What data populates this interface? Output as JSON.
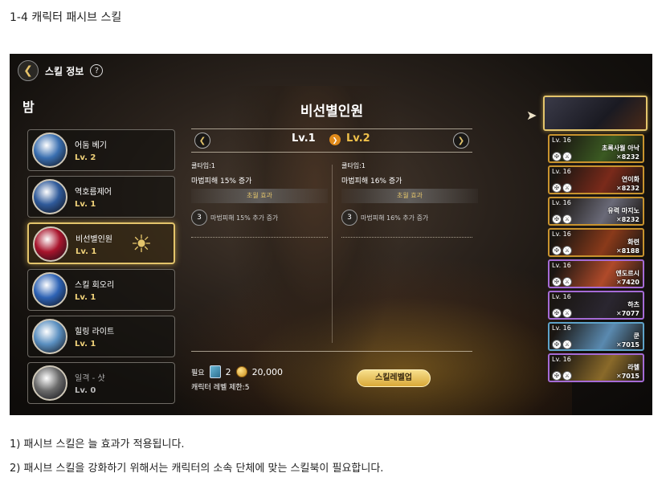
{
  "doc": {
    "heading": "1-4 캐릭터 패시브 스킬",
    "notes": [
      "1) 패시브 스킬은 늘 효과가 적용됩니다.",
      "2) 패시브 스킬을 강화하기 위해서는 캐릭터의 소속 단체에 맞는 스킬북이 필요합니다."
    ]
  },
  "game": {
    "topbar": {
      "back_icon": "back-arrow-icon",
      "title": "스킬 정보",
      "help_label": "?"
    },
    "character_name": "밤",
    "skills": [
      {
        "name": "어둠 베기",
        "level": "Lv. 2",
        "color": "#3a6fb0",
        "selected": false,
        "locked": false
      },
      {
        "name": "역호름제어",
        "level": "Lv. 1",
        "color": "#2f5a9a",
        "selected": false,
        "locked": false
      },
      {
        "name": "비선별인원",
        "level": "Lv. 1",
        "color": "#a8142c",
        "selected": true,
        "locked": false
      },
      {
        "name": "스킬 회오리",
        "level": "Lv. 1",
        "color": "#2e63b5",
        "selected": false,
        "locked": false
      },
      {
        "name": "힐링 라이트",
        "level": "Lv. 1",
        "color": "#5a8fc0",
        "selected": false,
        "locked": false
      },
      {
        "name": "일격 - 샷",
        "level": "Lv. 0",
        "color": "#6a6a6a",
        "selected": false,
        "locked": true
      }
    ],
    "detail": {
      "title": "비선별인원",
      "level_current": "Lv.1",
      "level_next": "Lv.2",
      "columns": [
        {
          "cooldown": "쿨타임:1",
          "damage": "마법피해 15% 증가",
          "ultra_label": "초월 효과",
          "extra_badge": "3",
          "extra_text": "마법피해 15% 추가 증가"
        },
        {
          "cooldown": "쿨타임:1",
          "damage": "마법피해 16% 증가",
          "ultra_label": "초월 효과",
          "extra_badge": "3",
          "extra_text": "마법피해 16% 추가 증가"
        }
      ]
    },
    "requirement": {
      "label": "필요",
      "book_count": "2",
      "gold": "20,000",
      "level_limit": "캐릭터 레벨 제한:5"
    },
    "levelup_button": "스킬레벨업",
    "heroes": [
      {
        "level": "Lv. 16",
        "name": "초록사월 아낙",
        "power": "8232",
        "border": "gold",
        "color": "#3b5a22"
      },
      {
        "level": "Lv. 16",
        "name": "연이화",
        "power": "8232",
        "border": "gold",
        "color": "#7a2a1a"
      },
      {
        "level": "Lv. 16",
        "name": "유력 마지노",
        "power": "8232",
        "border": "gold",
        "color": "#6a6a78"
      },
      {
        "level": "Lv. 16",
        "name": "화련",
        "power": "8188",
        "border": "gold",
        "color": "#8a3a1a"
      },
      {
        "level": "Lv. 16",
        "name": "엔도르시",
        "power": "7420",
        "border": "purple",
        "color": "#b04a2a"
      },
      {
        "level": "Lv. 16",
        "name": "하츠",
        "power": "7077",
        "border": "purple",
        "color": "#2a2630"
      },
      {
        "level": "Lv. 16",
        "name": "쿤",
        "power": "7015",
        "border": "blue",
        "color": "#5a8ab0"
      },
      {
        "level": "Lv. 16",
        "name": "라헬",
        "power": "7015",
        "border": "purple",
        "color": "#8a6a2a"
      }
    ]
  }
}
